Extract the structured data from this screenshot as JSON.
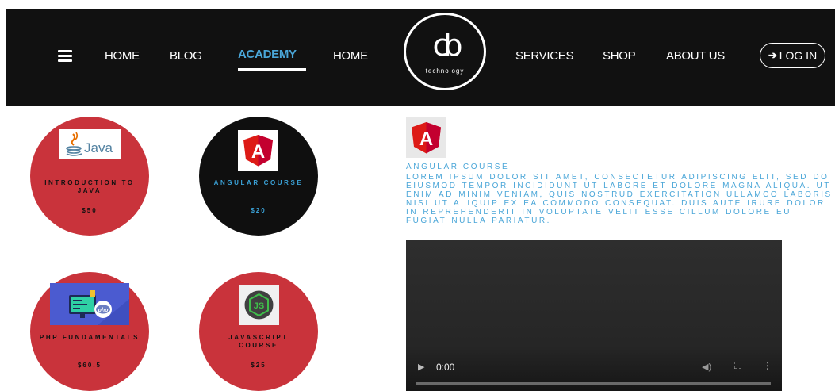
{
  "header": {
    "nav": [
      "HOME",
      "BLOG",
      "ACADEMY",
      "HOME",
      "SERVICES",
      "SHOP",
      "ABOUT US"
    ],
    "logo_mark": "cb",
    "logo_text": "technology",
    "login_label": "LOG IN"
  },
  "courses": [
    {
      "title": "INTRODUCTION TO JAVA",
      "price": "$50",
      "icon": "java-logo-icon",
      "logo_text": "Java"
    },
    {
      "title": "ANGULAR COURSE",
      "price": "$20",
      "icon": "angular-logo-icon",
      "logo_text": "A"
    },
    {
      "title": "PHP FUNDAMENTALS",
      "price": "$60.5",
      "icon": "php-illustration-icon",
      "logo_text": "php"
    },
    {
      "title": "JAVASCRIPT COURSE",
      "price": "$25",
      "icon": "nodejs-logo-icon",
      "logo_text": "JS"
    }
  ],
  "detail": {
    "title": "ANGULAR COURSE",
    "description": "LOREM IPSUM DOLOR SIT AMET, CONSECTETUR ADIPISCING ELIT, SED DO EIUSMOD TEMPOR INCIDIDUNT UT LABORE ET DOLORE MAGNA ALIQUA. UT ENIM AD MINIM VENIAM, QUIS NOSTRUD EXERCITATION ULLAMCO LABORIS NISI UT ALIQUIP EX EA COMMODO CONSEQUAT. DUIS AUTE IRURE DOLOR IN REPREHENDERIT IN VOLUPTATE VELIT ESSE CILLUM DOLORE EU FUGIAT NULLA PARIATUR.",
    "icon": "angular-logo-icon",
    "logo_text": "A"
  },
  "video": {
    "time": "0:00",
    "progress": 0
  },
  "colors": {
    "header_bg": "#111111",
    "accent_blue": "#4aa6d8",
    "card_red": "#c9333b",
    "card_black": "#0f0f0f",
    "angular_red": "#dd1b16"
  }
}
